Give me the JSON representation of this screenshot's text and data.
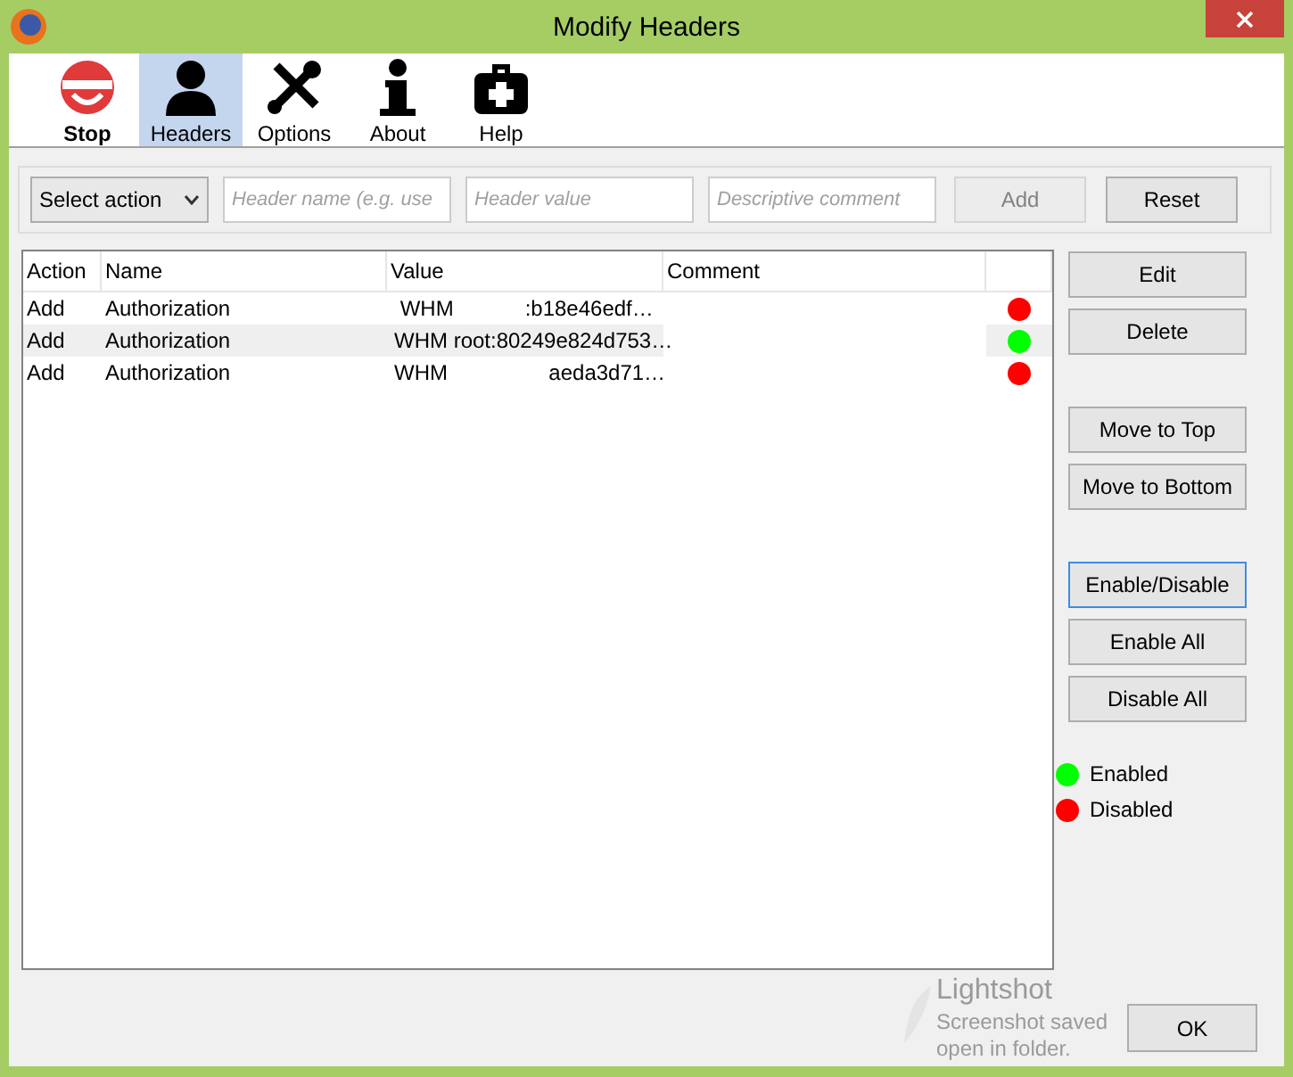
{
  "window": {
    "title": "Modify Headers"
  },
  "toolbar": [
    {
      "label": "Stop",
      "kind": "stop",
      "selected": false
    },
    {
      "label": "Headers",
      "kind": "headers",
      "selected": true
    },
    {
      "label": "Options",
      "kind": "options",
      "selected": false
    },
    {
      "label": "About",
      "kind": "about",
      "selected": false
    },
    {
      "label": "Help",
      "kind": "help",
      "selected": false
    }
  ],
  "filter": {
    "action": "Select action",
    "name_placeholder": "Header name (e.g. use",
    "value_placeholder": "Header value",
    "comment_placeholder": "Descriptive comment",
    "add": {
      "label": "Add",
      "disabled": true
    },
    "reset": {
      "label": "Reset",
      "disabled": false
    }
  },
  "table": {
    "columns": [
      "Action",
      "Name",
      "Value",
      "Comment"
    ],
    "rows": [
      {
        "action": "Add",
        "name": "Authorization",
        "value": " WHM            :b18e46edf…",
        "enabled": false,
        "selected": false
      },
      {
        "action": "Add",
        "name": "Authorization",
        "value": "WHM root:80249e824d753…",
        "enabled": true,
        "selected": true
      },
      {
        "action": "Add",
        "name": "Authorization",
        "value": "WHM                 aeda3d71…",
        "enabled": false,
        "selected": false
      }
    ]
  },
  "side_button_groups": [
    [
      {
        "label": "Edit",
        "focused": false
      },
      {
        "label": "Delete",
        "focused": false
      }
    ],
    [
      {
        "label": "Move to Top",
        "focused": false
      },
      {
        "label": "Move to Bottom",
        "focused": false
      }
    ],
    [
      {
        "label": "Enable/Disable",
        "focused": true
      },
      {
        "label": "Enable All",
        "focused": false
      },
      {
        "label": "Disable All",
        "focused": false
      }
    ]
  ],
  "legend": [
    {
      "label": "Enabled",
      "color": "#00ff00"
    },
    {
      "label": "Disabled",
      "color": "#ff0000"
    }
  ],
  "notification": {
    "title": "Lightshot",
    "line_1": "Screenshot saved",
    "line_2": "open in folder."
  },
  "ok": "OK"
}
